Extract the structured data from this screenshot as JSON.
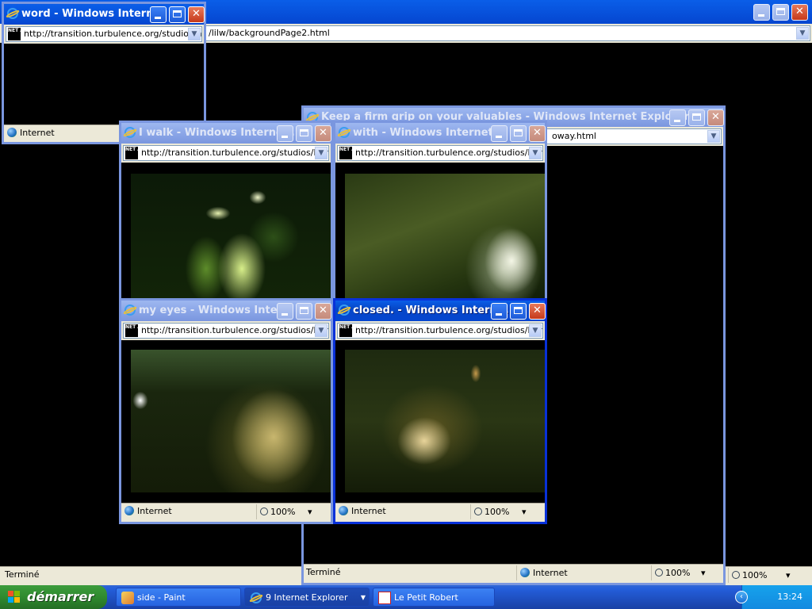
{
  "windows": {
    "main": {
      "url": "/lilw/backgroundPage2.html",
      "status": "Terminé",
      "zoom": "100%"
    },
    "word": {
      "title": "word - Windows Intern...",
      "url": "http://transition.turbulence.org/studios/ho",
      "status_zone": "Internet"
    },
    "valuables": {
      "title": "Keep a firm grip on your valuables - Windows Internet Explorer",
      "url": "oway.html",
      "status": "Terminé",
      "status_zone": "Internet",
      "zoom": "100%"
    },
    "iwalk": {
      "title": "I walk - Windows Interne...",
      "url": "http://transition.turbulence.org/studios/horva"
    },
    "with": {
      "title": "with - Windows Internet ...",
      "url": "http://transition.turbulence.org/studios/horva"
    },
    "myeyes": {
      "title": "my eyes - Windows Inter...",
      "url": "http://transition.turbulence.org/studios/horva",
      "status_zone": "Internet",
      "zoom": "100%"
    },
    "closed": {
      "title": "closed. - Windows Intern...",
      "url": "http://transition.turbulence.org/studios/horva",
      "status_zone": "Internet",
      "zoom": "100%"
    }
  },
  "netart_icon": "NET ART",
  "taskbar": {
    "start_label": "démarrer",
    "buttons": [
      {
        "label": "side - Paint"
      },
      {
        "label": "9 Internet Explorer"
      },
      {
        "label": "Le Petit Robert"
      }
    ],
    "clock": "13:24",
    "tray_arrow": "‹"
  },
  "glyphs": {
    "dropdown": "▼",
    "zoom_caret": "▾"
  }
}
